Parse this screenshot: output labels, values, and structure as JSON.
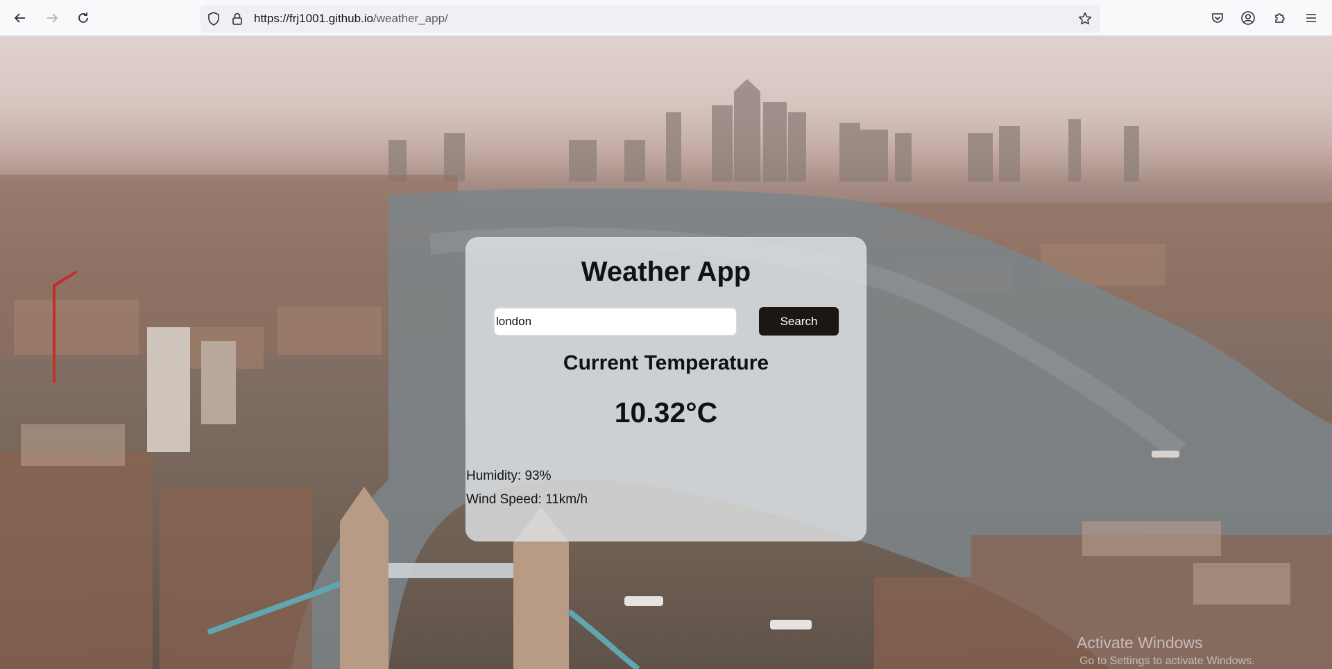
{
  "browser": {
    "url_host": "https://frj1001.github.io",
    "url_path": "/weather_app/",
    "icons": {
      "back": "back-arrow-icon",
      "forward": "forward-arrow-icon",
      "reload": "reload-icon",
      "tracking": "shield-icon",
      "lock": "lock-icon",
      "bookmark": "star-icon",
      "pocket": "pocket-icon",
      "account": "account-icon",
      "extensions": "puzzle-icon",
      "menu": "hamburger-menu-icon"
    }
  },
  "weather": {
    "title": "Weather App",
    "search_value": "london",
    "search_button": "Search",
    "temp_heading": "Current Temperature",
    "temperature": "10.32°C",
    "humidity": "Humidity: 93%",
    "wind_speed": "Wind Speed: 11km/h"
  },
  "watermark": {
    "title": "Activate Windows",
    "subtitle": "Go to Settings to activate Windows."
  },
  "colors": {
    "search_button_bg": "#1a1715",
    "card_bg": "#dee2e4",
    "browser_bg": "#f9f9fb"
  }
}
